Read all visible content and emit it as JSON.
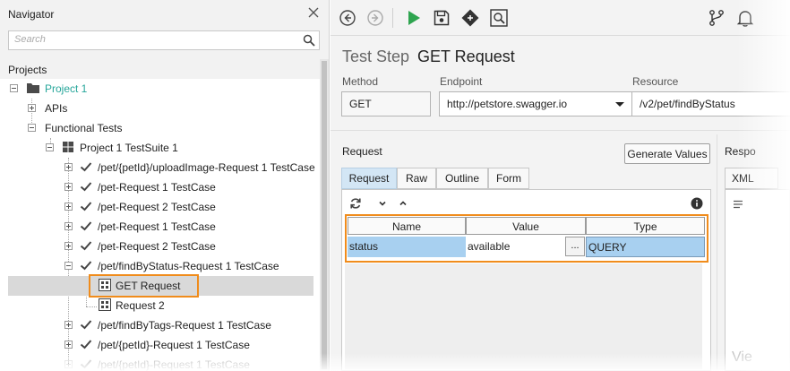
{
  "navigator": {
    "title": "Navigator",
    "search_placeholder": "Search",
    "projects_label": "Projects",
    "tree": {
      "project": "Project 1",
      "apis": "APIs",
      "functional_tests": "Functional Tests",
      "suite": "Project 1 TestSuite 1",
      "cases": [
        "/pet/{petId}/uploadImage-Request 1 TestCase",
        "/pet-Request 1 TestCase",
        "/pet-Request 2 TestCase",
        "/pet-Request 1 TestCase",
        "/pet-Request 2 TestCase",
        "/pet/findByStatus-Request 1 TestCase"
      ],
      "steps": [
        "GET Request",
        "Request 2"
      ],
      "more_cases": [
        "/pet/findByTags-Request 1 TestCase",
        "/pet/{petId}-Request 1 TestCase",
        "/pet/{petId}-Request 1 TestCase"
      ]
    }
  },
  "editor": {
    "title_prefix": "Test Step",
    "title": "GET Request",
    "method_label": "Method",
    "method_value": "GET",
    "endpoint_label": "Endpoint",
    "endpoint_value": "http://petstore.swagger.io",
    "resource_label": "Resource",
    "resource_value": "/v2/pet/findByStatus",
    "request_label": "Request",
    "generate_button": "Generate Values",
    "tabs": [
      "Request",
      "Raw",
      "Outline",
      "Form"
    ],
    "grid": {
      "headers": [
        "Name",
        "Value",
        "Type"
      ],
      "row": {
        "name": "status",
        "value": "available",
        "type": "QUERY",
        "dots": "..."
      }
    },
    "response_label": "Respo",
    "response_tab": "XML",
    "response_ghost": "Vie"
  },
  "colors": {
    "highlight": "#f08c1c",
    "project": "#26a69a",
    "run": "#2ea44f",
    "selected_cell": "#a8d0f0",
    "active_tab": "#d3e6f5"
  }
}
